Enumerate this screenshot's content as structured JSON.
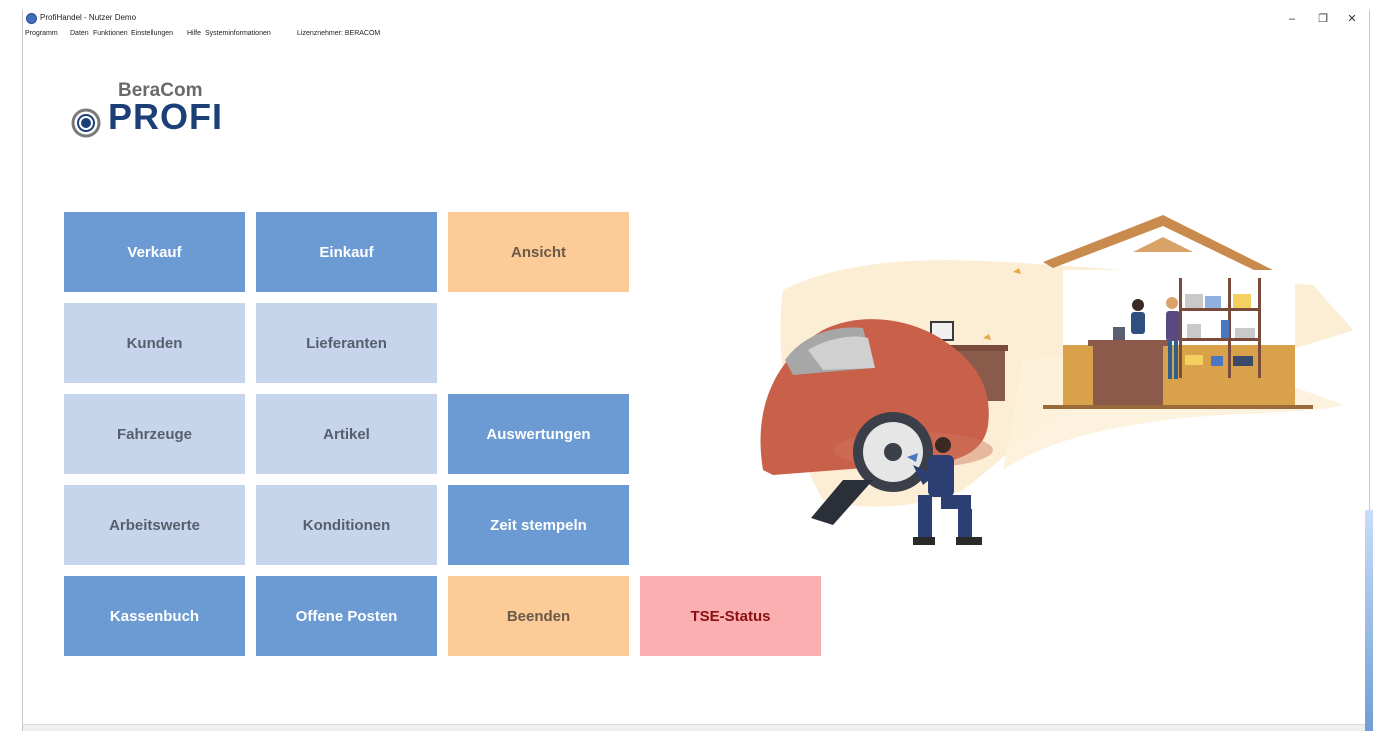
{
  "window": {
    "title": "ProfiHandel - Nutzer Demo",
    "controls": {
      "minimize": "–",
      "maximize": "❐",
      "close": "✕"
    }
  },
  "menubar": {
    "items": [
      "Programm",
      "Daten",
      "Funktionen",
      "Einstellungen",
      "Hilfe",
      "Systeminformationen",
      "Lizenznehmer: BERACOM"
    ]
  },
  "logo": {
    "small": "BeraCom",
    "big": "PROFI"
  },
  "tiles": [
    {
      "label": "Verkauf"
    },
    {
      "label": "Einkauf"
    },
    {
      "label": "Ansicht"
    },
    {
      "label": "Kunden"
    },
    {
      "label": "Lieferanten"
    },
    {
      "label": "Fahrzeuge"
    },
    {
      "label": "Artikel"
    },
    {
      "label": "Auswertungen"
    },
    {
      "label": "Arbeitswerte"
    },
    {
      "label": "Konditionen"
    },
    {
      "label": "Zeit stempeln"
    },
    {
      "label": "Kassenbuch"
    },
    {
      "label": "Offene Posten"
    },
    {
      "label": "Beenden"
    },
    {
      "label": "TSE-Status"
    }
  ],
  "colors": {
    "tile_blue": "#6c9bd3",
    "tile_light": "#c7d5ec",
    "tile_orange": "#fdcb98",
    "tile_pink": "#fab0b0",
    "tse_text": "#8b0f12",
    "logo_blue": "#1c3f78",
    "car_red": "#c9604a"
  },
  "illustration": {
    "icon": "car-workshop-illustration"
  }
}
